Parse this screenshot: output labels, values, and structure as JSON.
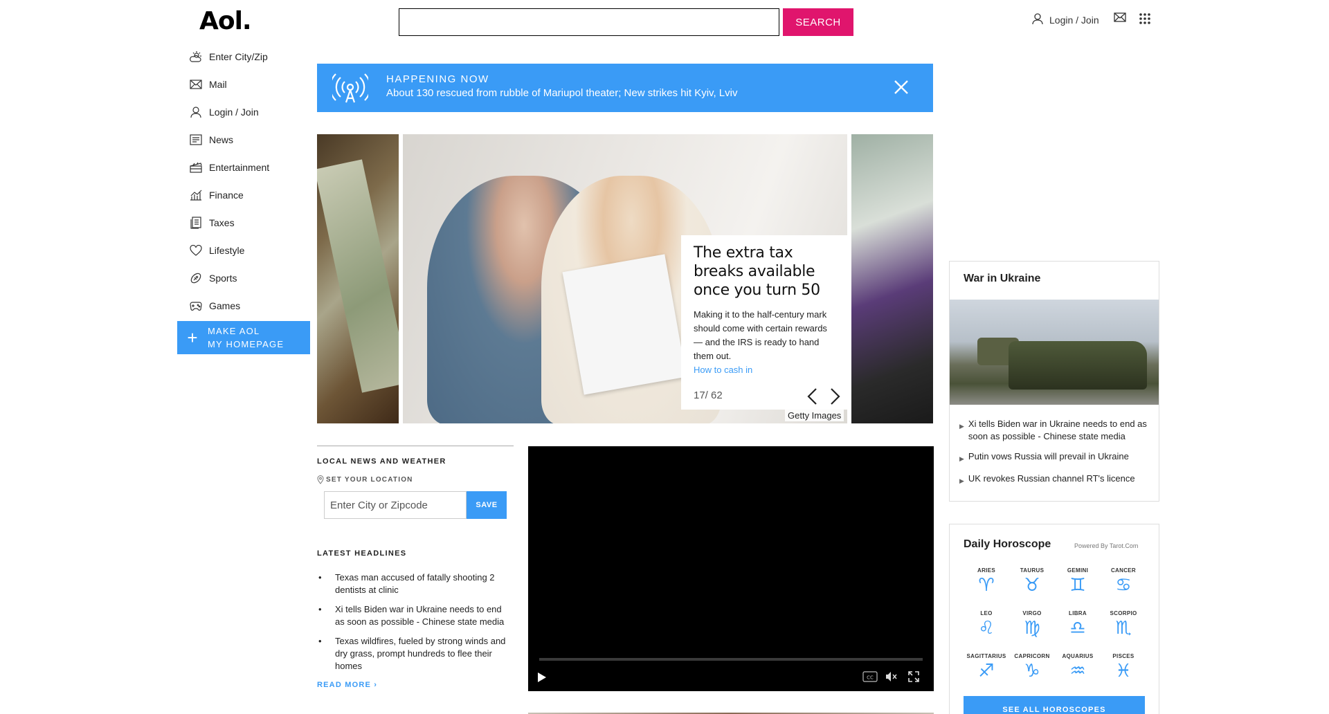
{
  "header": {
    "logo": "Aol.",
    "search_placeholder": "",
    "search_label": "SEARCH",
    "login_label": "Login / Join"
  },
  "sidebar": {
    "items": [
      {
        "label": "Enter City/Zip",
        "icon": "weather-icon"
      },
      {
        "label": "Mail",
        "icon": "mail-icon"
      },
      {
        "label": "Login / Join",
        "icon": "user-icon"
      },
      {
        "label": "News",
        "icon": "news-icon"
      },
      {
        "label": "Entertainment",
        "icon": "clapper-icon"
      },
      {
        "label": "Finance",
        "icon": "chart-icon"
      },
      {
        "label": "Taxes",
        "icon": "document-icon"
      },
      {
        "label": "Lifestyle",
        "icon": "heart-icon"
      },
      {
        "label": "Sports",
        "icon": "football-icon"
      },
      {
        "label": "Games",
        "icon": "gamepad-icon"
      }
    ],
    "make_homepage_line1": "MAKE AOL",
    "make_homepage_line2": "MY HOMEPAGE"
  },
  "banner": {
    "label": "HAPPENING NOW",
    "headline": "About 130 rescued from rubble of Mariupol theater; New strikes hit Kyiv, Lviv",
    "color": "#3a9bf6"
  },
  "slideshow": {
    "title": "The extra tax breaks available once you turn 50",
    "description": "Making it to the half-century mark should come with certain rewards — and the IRS is ready to hand them out.",
    "link": "How to cash in",
    "counter": "17/ 62",
    "credit": "Getty Images"
  },
  "local": {
    "title": "LOCAL NEWS AND WEATHER",
    "set_location": "SET YOUR LOCATION",
    "zip_placeholder": "Enter City or Zipcode",
    "save_label": "SAVE",
    "headlines_title": "LATEST HEADLINES",
    "headlines": [
      "Texas man accused of fatally shooting 2 dentists at clinic",
      "Xi tells Biden war in Ukraine needs to end as soon as possible - Chinese state media",
      "Texas wildfires, fueled by strong winds and dry grass, prompt hundreds to flee their homes"
    ],
    "read_more": "READ MORE ›"
  },
  "video": {
    "cc_label": "CC"
  },
  "war": {
    "title": "War in Ukraine",
    "items": [
      "Xi tells Biden war in Ukraine needs to end as soon as possible - Chinese state media",
      "Putin vows Russia will prevail in Ukraine",
      "UK revokes Russian channel RT's licence"
    ]
  },
  "horoscope": {
    "title": "Daily Horoscope",
    "powered_by": "Powered By Tarot.Com",
    "signs": [
      {
        "name": "ARIES",
        "glyph": "♈"
      },
      {
        "name": "TAURUS",
        "glyph": "♉"
      },
      {
        "name": "GEMINI",
        "glyph": "♊"
      },
      {
        "name": "CANCER",
        "glyph": "♋"
      },
      {
        "name": "LEO",
        "glyph": "♌"
      },
      {
        "name": "VIRGO",
        "glyph": "♍"
      },
      {
        "name": "LIBRA",
        "glyph": "♎"
      },
      {
        "name": "SCORPIO",
        "glyph": "♏"
      },
      {
        "name": "SAGITTARIUS",
        "glyph": "♐"
      },
      {
        "name": "CAPRICORN",
        "glyph": "♑"
      },
      {
        "name": "AQUARIUS",
        "glyph": "♒"
      },
      {
        "name": "PISCES",
        "glyph": "♓"
      }
    ],
    "see_all": "SEE ALL HOROSCOPES"
  },
  "colors": {
    "accent": "#3a9bf6",
    "search_button": "#e0156d"
  }
}
